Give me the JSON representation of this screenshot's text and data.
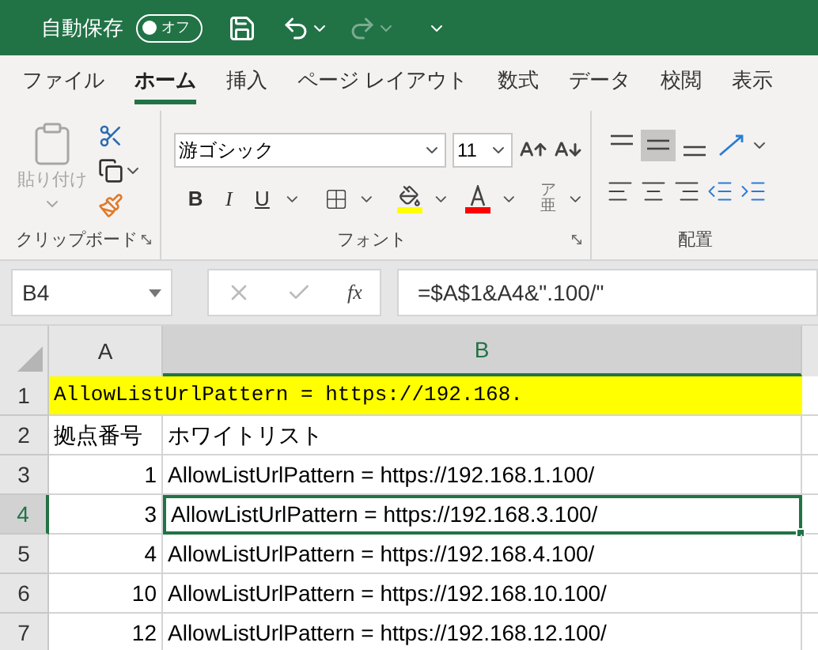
{
  "title_bar": {
    "autosave_label": "自動保存",
    "autosave_toggle": {
      "text": "オフ",
      "on": false
    }
  },
  "tabs": [
    {
      "label": "ファイル",
      "selected": false
    },
    {
      "label": "ホーム",
      "selected": true
    },
    {
      "label": "挿入",
      "selected": false
    },
    {
      "label": "ページ レイアウト",
      "selected": false
    },
    {
      "label": "数式",
      "selected": false
    },
    {
      "label": "データ",
      "selected": false
    },
    {
      "label": "校閲",
      "selected": false
    },
    {
      "label": "表示",
      "selected": false
    }
  ],
  "ribbon": {
    "paste": {
      "label": "貼り付け",
      "disabled": true
    },
    "font_name": "游ゴシック",
    "font_size": "11",
    "format_buttons": [
      "B",
      "I",
      "U"
    ],
    "phonetic": [
      "ア",
      "亜"
    ],
    "fill_button": {
      "color": "#ffff00"
    },
    "font_color_button": {
      "color": "#ff0000"
    },
    "groups": [
      "クリップボード",
      "フォント",
      "配置"
    ]
  },
  "formula_bar": {
    "name_box": "B4",
    "function_button": "fx",
    "formula": "=$A$1&A4&\".100/\""
  },
  "columns": [
    {
      "label": "A",
      "selected": false
    },
    {
      "label": "B",
      "selected": true
    }
  ],
  "rows": [
    {
      "number": "1",
      "kind": "banner",
      "selected": false,
      "color": "#ffff00",
      "a": "AllowListUrlPattern = https://192.168."
    },
    {
      "number": "2",
      "kind": "header",
      "selected": false,
      "a": "拠点番号",
      "b": "ホワイトリスト"
    },
    {
      "number": "3",
      "kind": "data",
      "selected": false,
      "a": "1",
      "b": "AllowListUrlPattern = https://192.168.1.100/"
    },
    {
      "number": "4",
      "kind": "data",
      "selected": true,
      "a": "3",
      "b": "AllowListUrlPattern = https://192.168.3.100/"
    },
    {
      "number": "5",
      "kind": "data",
      "selected": false,
      "a": "4",
      "b": "AllowListUrlPattern = https://192.168.4.100/"
    },
    {
      "number": "6",
      "kind": "data",
      "selected": false,
      "a": "10",
      "b": "AllowListUrlPattern = https://192.168.10.100/"
    },
    {
      "number": "7",
      "kind": "data",
      "selected": false,
      "a": "12",
      "b": "AllowListUrlPattern = https://192.168.12.100/"
    }
  ]
}
